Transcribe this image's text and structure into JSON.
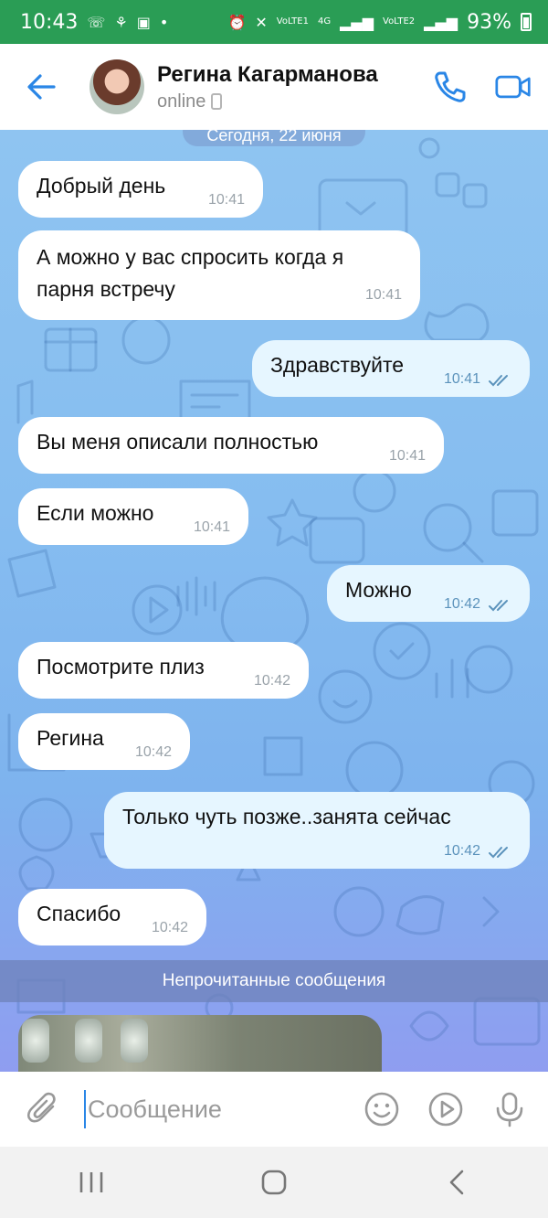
{
  "status_bar": {
    "time": "10:43",
    "network_1": "VoLTE1",
    "network_2": "VoLTE2",
    "net_type": "4G",
    "battery": "93%"
  },
  "header": {
    "name": "Регина Кагарманова",
    "status": "online"
  },
  "date_separator": "Сегодня, 22 июня",
  "messages": [
    {
      "dir": "in",
      "text": "Добрый день",
      "time": "10:41"
    },
    {
      "dir": "in",
      "text": "А можно у вас спросить когда я парня встречу",
      "time": "10:41"
    },
    {
      "dir": "out",
      "text": "Здравствуйте",
      "time": "10:41"
    },
    {
      "dir": "in",
      "text": "Вы меня описали полностью",
      "time": "10:41"
    },
    {
      "dir": "in",
      "text": "Если можно",
      "time": "10:41"
    },
    {
      "dir": "out",
      "text": "Можно",
      "time": "10:42"
    },
    {
      "dir": "in",
      "text": "Посмотрите плиз",
      "time": "10:42"
    },
    {
      "dir": "in",
      "text": "Регина",
      "time": "10:42"
    },
    {
      "dir": "out",
      "text": "Только чуть позже..занята сейчас",
      "time": "10:42"
    },
    {
      "dir": "in",
      "text": "Спасибо",
      "time": "10:42"
    }
  ],
  "unread_label": "Непрочитанные сообщения",
  "composer": {
    "placeholder": "Сообщение"
  },
  "icons": {
    "back": "arrow-left-icon",
    "call": "phone-icon",
    "video": "video-camera-icon",
    "attach": "paperclip-icon",
    "emoji": "smiley-icon",
    "video_message": "play-circle-icon",
    "mic": "microphone-icon",
    "nav_recents": "recents-icon",
    "nav_home": "home-icon",
    "nav_back": "back-chevron-icon"
  },
  "colors": {
    "accent": "#2a86e6",
    "status_bar": "#2a9d55",
    "outgoing_bubble": "#e6f6ff",
    "incoming_bubble": "#ffffff"
  }
}
